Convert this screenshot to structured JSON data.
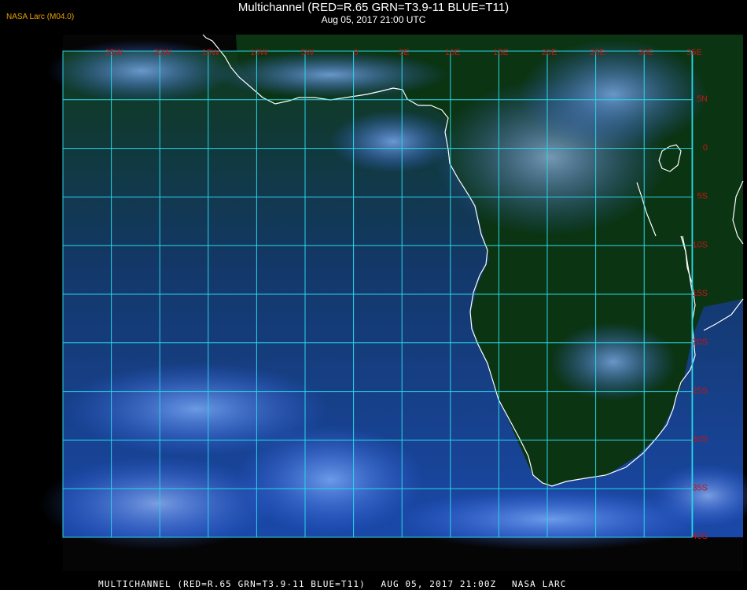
{
  "header": {
    "title": "Multichannel (RED=R.65 GRN=T3.9-11 BLUE=T11)",
    "subtitle": "Aug 05, 2017 21:00 UTC",
    "badge": "NASA Larc (M04.0)"
  },
  "footer": {
    "product": "MULTICHANNEL (RED=R.65 GRN=T3.9-11 BLUE=T11)",
    "date": "AUG 05, 2017 21:00Z",
    "source": "NASA LARC"
  },
  "map": {
    "lon_labels": [
      "25W",
      "20W",
      "15W",
      "10W",
      "5W",
      "0",
      "5E",
      "10E",
      "15E",
      "20E",
      "25E",
      "30E",
      "35E"
    ],
    "lat_labels": [
      "5N",
      "0",
      "5S",
      "10S",
      "15S",
      "20S",
      "25S",
      "30S",
      "35S",
      "40S"
    ],
    "colors": {
      "grid": "#27d7e8",
      "labels": "#c21616",
      "coastline": "#ffffff",
      "clouds": "#6fa0ff",
      "ocean": "#1a3f80",
      "land": "#0a3a12"
    }
  }
}
